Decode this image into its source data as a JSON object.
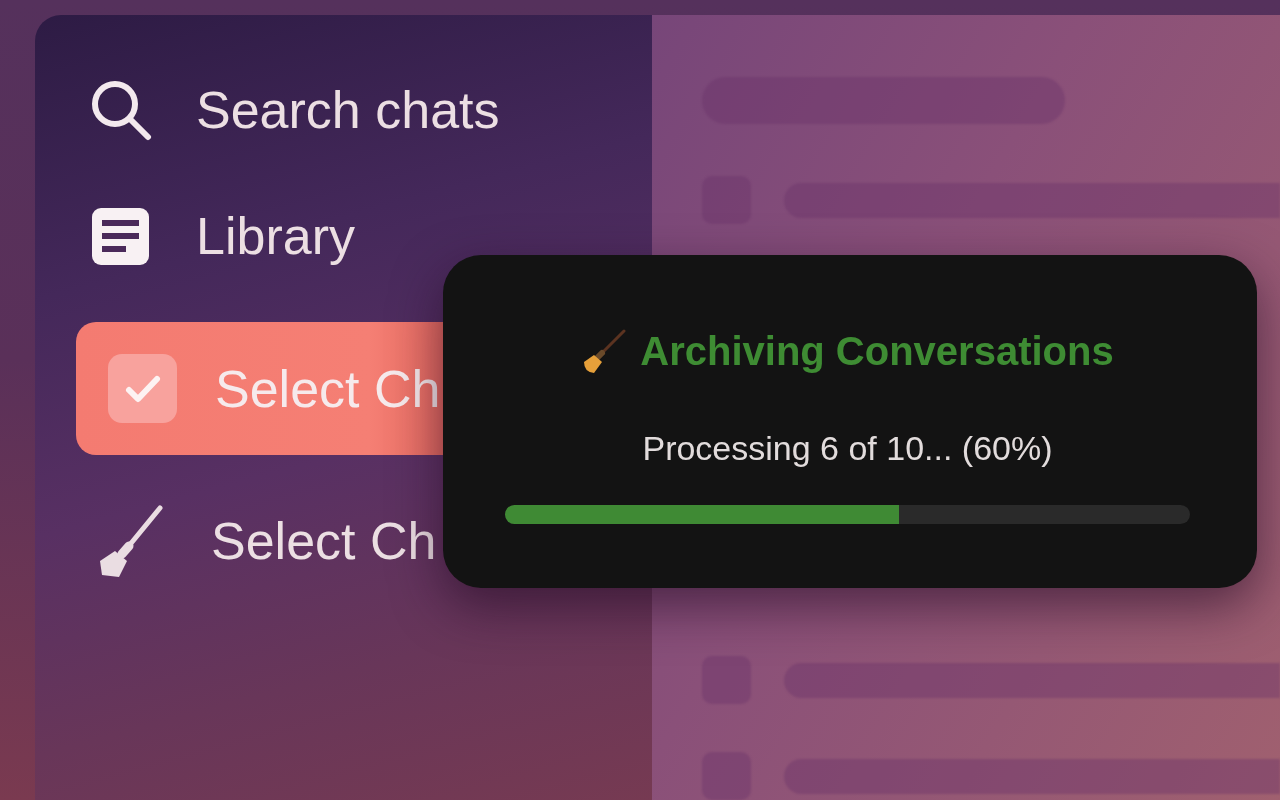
{
  "sidebar": {
    "items": [
      {
        "label": "Search chats",
        "kind": "search",
        "selected": false
      },
      {
        "label": "Library",
        "kind": "library",
        "selected": false
      },
      {
        "label": "Select Ch",
        "kind": "select",
        "selected": true
      },
      {
        "label": "Select Ch",
        "kind": "cleanup",
        "selected": false
      }
    ]
  },
  "dialog": {
    "title": "Archiving Conversations",
    "message": "Processing 6 of 10... (60%)",
    "progress": {
      "level": 0.575
    }
  }
}
